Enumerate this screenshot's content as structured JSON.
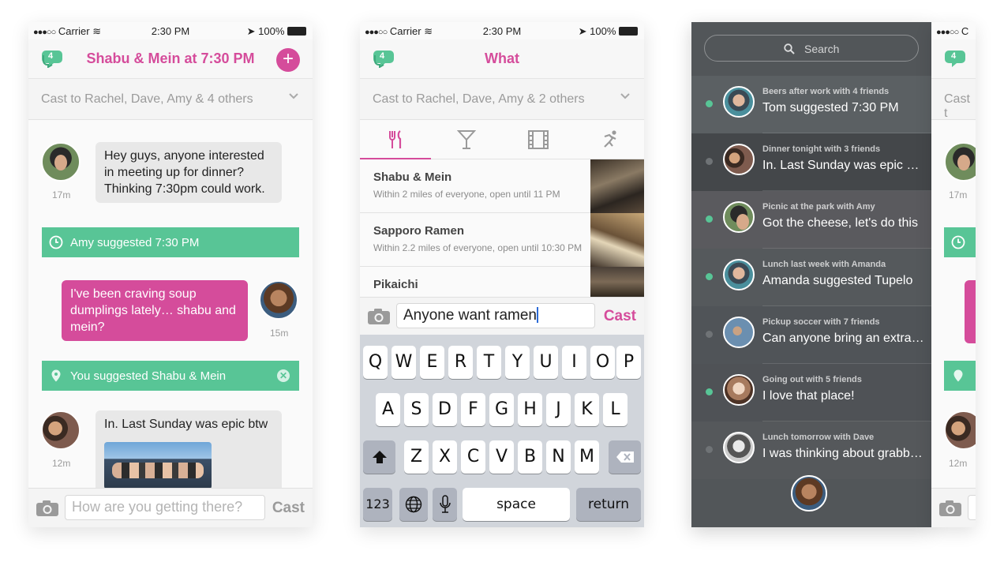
{
  "colors": {
    "accent_pink": "#d54c9b",
    "accent_green": "#58c596",
    "dark_panel": "#525659"
  },
  "status": {
    "carrier": "Carrier",
    "time": "2:30 PM",
    "battery": "100%"
  },
  "chat_screen": {
    "badge_count": "4",
    "title": "Shabu & Mein at 7:30 PM",
    "plus_label": "+",
    "cast_to": "Cast to Rachel, Dave, Amy & 4 others",
    "messages": [
      {
        "text": "Hey guys, anyone interested in meeting up for dinner? Thinking 7:30pm could work.",
        "time": "17m"
      },
      {
        "text": "I've been craving soup dumplings lately… shabu and mein?",
        "time": "15m"
      },
      {
        "text": "In. Last Sunday was epic btw",
        "time": "12m"
      }
    ],
    "events": [
      {
        "text": "Amy suggested 7:30 PM",
        "icon": "clock-icon"
      },
      {
        "text": "You suggested Shabu & Mein",
        "icon": "map-pin-icon"
      }
    ],
    "compose_placeholder": "How are you getting there?",
    "cast_label": "Cast"
  },
  "what_screen": {
    "badge_count": "4",
    "title": "What",
    "cast_to": "Cast to Rachel, Dave, Amy & 2 others",
    "tabs": [
      {
        "icon": "food-icon"
      },
      {
        "icon": "drinks-icon"
      },
      {
        "icon": "movies-icon"
      },
      {
        "icon": "activity-icon"
      }
    ],
    "places": [
      {
        "name": "Shabu & Mein",
        "desc": "Within 2 miles of everyone, open until 11 PM"
      },
      {
        "name": "Sapporo Ramen",
        "desc": "Within 2.2 miles of everyone, open until 10:30 PM"
      },
      {
        "name": "Pikaichi",
        "desc": ""
      }
    ],
    "compose_value": "Anyone want ramen",
    "cast_label": "Cast",
    "keyboard": {
      "row1": [
        "Q",
        "W",
        "E",
        "R",
        "T",
        "Y",
        "U",
        "I",
        "O",
        "P"
      ],
      "row2": [
        "A",
        "S",
        "D",
        "F",
        "G",
        "H",
        "J",
        "K",
        "L"
      ],
      "row3": [
        "Z",
        "X",
        "C",
        "V",
        "B",
        "N",
        "M"
      ],
      "numbers": "123",
      "space": "space",
      "return": "return"
    }
  },
  "list_screen": {
    "search_placeholder": "Search",
    "conversations": [
      {
        "sub": "Beers after work with 4 friends",
        "msg": "Tom suggested 7:30 PM",
        "unread": true
      },
      {
        "sub": "Dinner tonight with 3 friends",
        "msg": "In. Last Sunday was epic btw",
        "unread": false
      },
      {
        "sub": "Picnic at the park with Amy",
        "msg": "Got the cheese, let's do this",
        "unread": true
      },
      {
        "sub": "Lunch last week with Amanda",
        "msg": "Amanda suggested Tupelo",
        "unread": true
      },
      {
        "sub": "Pickup soccer with 7 friends",
        "msg": "Can anyone bring an extra ball?",
        "unread": false
      },
      {
        "sub": "Going out with 5 friends",
        "msg": "I love that place!",
        "unread": true
      },
      {
        "sub": "Lunch tomorrow with Dave",
        "msg": "I was thinking about grabbing lunch",
        "unread": false
      }
    ]
  },
  "peek_screen": {
    "status_signal": "●●●○○",
    "status_carrier": "C",
    "badge_count": "4",
    "cast_fragment": "Cast t",
    "time_1": "17m",
    "time_2": "12m"
  }
}
